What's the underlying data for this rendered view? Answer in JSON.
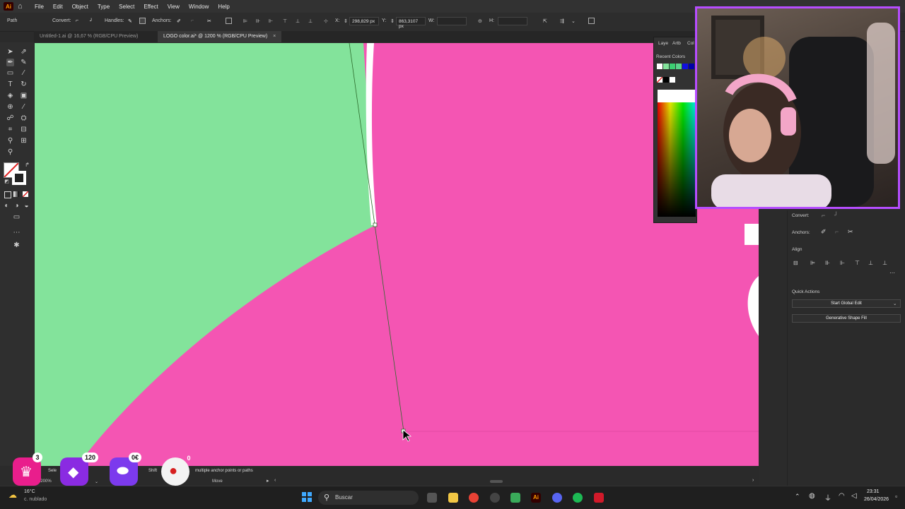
{
  "menubar": {
    "logo": "Ai",
    "items": [
      "File",
      "Edit",
      "Object",
      "Type",
      "Select",
      "Effect",
      "View",
      "Window",
      "Help"
    ]
  },
  "controlbar": {
    "selection_label": "Path",
    "convert_label": "Convert:",
    "handles_label": "Handles:",
    "anchors_label": "Anchors:",
    "x_label": "X:",
    "x_value": "298,829 px",
    "y_label": "Y:",
    "y_value": "863,3107 px",
    "w_label": "W:",
    "h_label": "H:"
  },
  "tabs": [
    {
      "label": "Untitled-1.ai @ 16,67 % (RGB/CPU Preview)",
      "active": false
    },
    {
      "label": "LOGO color.ai* @ 1200 % (RGB/CPU Preview)",
      "active": true
    }
  ],
  "colors": {
    "canvas_pink": "#f455b3",
    "shape_green": "#83e39b",
    "accent_purple": "#b64dff"
  },
  "color_panel": {
    "tab_layers": "Laye",
    "tab_artboards": "Artb",
    "tab_color": "Col",
    "recent_colors_label": "Recent Colors"
  },
  "properties": {
    "convert_label": "Convert:",
    "anchors_label": "Anchors:",
    "align_title": "Align",
    "quick_actions_title": "Quick Actions",
    "start_global_edit": "Start Global Edit",
    "generative_shape_fill": "Generative Shape Fill"
  },
  "statusbar": {
    "zoom": "1200%",
    "hint": "Sele",
    "hint2": "Shift",
    "hint_text": "multiple anchor points or paths",
    "move_label": "Move"
  },
  "overlay": {
    "crown_count": "3",
    "gem_count": "120",
    "money_count": "0€",
    "bomb_count": "0"
  },
  "taskbar": {
    "weather_temp": "16°C",
    "weather_desc": "c. nublado",
    "search_placeholder": "Buscar",
    "time": "23:31",
    "date": "26/04/2026"
  }
}
